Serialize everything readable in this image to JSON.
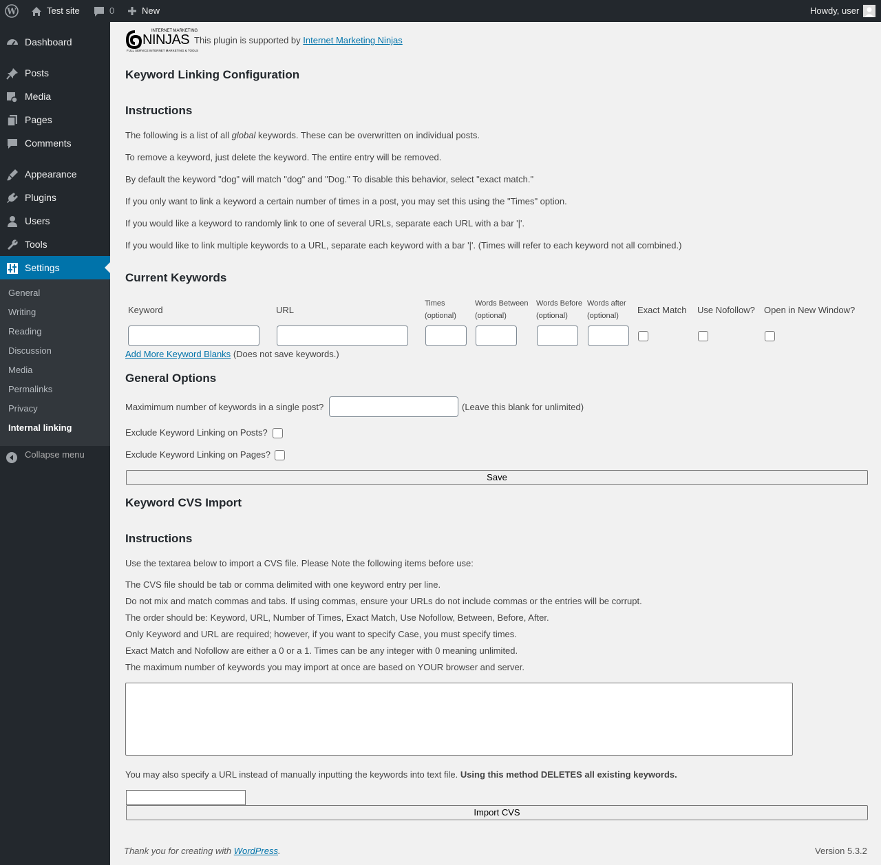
{
  "admin_bar": {
    "site_name": "Test site",
    "comments_count": "0",
    "new_label": "New",
    "greeting": "Howdy, user"
  },
  "sidebar": {
    "items": [
      {
        "label": "Dashboard",
        "icon": "dashboard-icon"
      },
      {
        "label": "Posts",
        "icon": "pin-icon"
      },
      {
        "label": "Media",
        "icon": "media-icon"
      },
      {
        "label": "Pages",
        "icon": "pages-icon"
      },
      {
        "label": "Comments",
        "icon": "comment-icon"
      },
      {
        "label": "Appearance",
        "icon": "brush-icon"
      },
      {
        "label": "Plugins",
        "icon": "plugin-icon"
      },
      {
        "label": "Users",
        "icon": "user-icon"
      },
      {
        "label": "Tools",
        "icon": "wrench-icon"
      },
      {
        "label": "Settings",
        "icon": "settings-icon"
      }
    ],
    "submenu": [
      "General",
      "Writing",
      "Reading",
      "Discussion",
      "Media",
      "Permalinks",
      "Privacy",
      "Internal linking"
    ],
    "collapse_label": "Collapse menu",
    "accent_color": "#0073aa"
  },
  "main": {
    "logo_top": "INTERNET MARKETING",
    "logo_word": "NINJAS",
    "logo_sub": "FULL SERVICE INTERNET MARKETING & TOOLS",
    "support_text": "This plugin is supported by",
    "support_link": "Internet Marketing Ninjas",
    "title": "Keyword Linking Configuration",
    "instructions_heading": "Instructions",
    "instr1_a": "The following is a list of all",
    "instr1_em": "global",
    "instr1_b": "keywords. These can be overwritten on individual posts.",
    "instr2": "To remove a keyword, just delete the keyword. The entire entry will be removed.",
    "instr3": "By default the keyword \"dog\" will match \"dog\" and \"Dog.\" To disable this behavior, select \"exact match.\"",
    "instr4": "If you only want to link a keyword a certain number of times in a post, you may set this using the \"Times\" option.",
    "instr5": "If you would like a keyword to randomly link to one of several URLs, separate each URL with a bar '|'.",
    "instr6": "If you would like to link multiple keywords to a URL, separate each keyword with a bar '|'. (Times will refer to each keyword not all combined.)",
    "current_heading": "Current Keywords",
    "columns": {
      "keyword": "Keyword",
      "url": "URL",
      "times": "Times",
      "words_between": "Words Between",
      "words_before": "Words Before",
      "words_after": "Words after",
      "optional": "(optional)",
      "exact_match": "Exact Match",
      "use_nofollow": "Use Nofollow?",
      "new_window": "Open in New Window?"
    },
    "add_more_link": "Add More Keyword Blanks",
    "add_more_note": "(Does not save keywords.)",
    "general_heading": "General Options",
    "max_label": "Maximimum number of keywords in a single post?",
    "max_value": "",
    "max_note": "(Leave this blank for unlimited)",
    "exclude_posts": "Exclude Keyword Linking on Posts?",
    "exclude_pages": "Exclude Keyword Linking on Pages?",
    "save_label": "Save",
    "import_heading": "Keyword CVS Import",
    "import_instructions_heading": "Instructions",
    "import_intro": "Use the textarea below to import a CVS file. Please Note the following items before use:",
    "import_lines": [
      "The CVS file should be tab or comma delimited with one keyword entry per line.",
      "Do not mix and match commas and tabs. If using commas, ensure your URLs do not include commas or the entries will be corrupt.",
      "The order should be: Keyword, URL, Number of Times, Exact Match, Use Nofollow, Between, Before, After.",
      "Only Keyword and URL are required; however, if you want to specify Case, you must specify times.",
      "Exact Match and Nofollow are either a 0 or a 1. Times can be any integer with 0 meaning unlimited.",
      "The maximum number of keywords you may import at once are based on YOUR browser and server."
    ],
    "url_note": "You may also specify a URL instead of manually inputting the keywords into text file.",
    "url_note_bold": "Using this method DELETES all existing keywords.",
    "import_button": "Import CVS"
  },
  "footer": {
    "thanks": "Thank you for creating with",
    "wp_link": "WordPress",
    "period": ".",
    "version": "Version 5.3.2"
  }
}
